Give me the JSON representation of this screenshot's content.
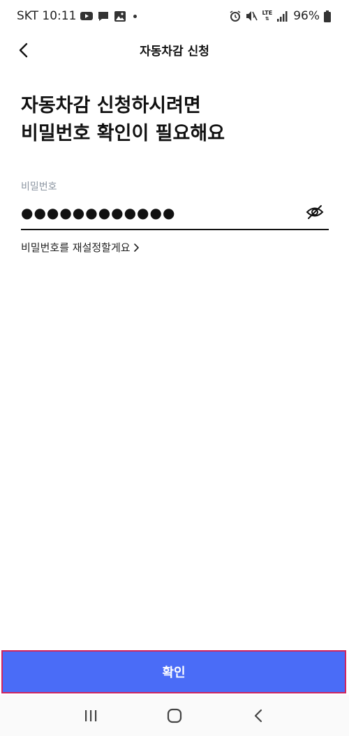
{
  "status_bar": {
    "carrier_time": "SKT 10:11",
    "network": "LTE",
    "battery": "96%"
  },
  "header": {
    "title": "자동차감 신청",
    "back_icon": "chevron-left-icon"
  },
  "headline": {
    "line1": "자동차감 신청하시려면",
    "line2": "비밀번호 확인이 필요해요"
  },
  "password_field": {
    "label": "비밀번호",
    "value": "●●●●●●●●●●●●",
    "toggle_icon": "eye-off-icon"
  },
  "reset_link": {
    "label": "비밀번호를 재설정할게요"
  },
  "confirm_button": {
    "label": "확인",
    "background_color": "#4a6cf7",
    "border_color": "#d0245e"
  },
  "nav_bar": {
    "recents_icon": "recents-icon",
    "home_icon": "home-icon",
    "back_icon": "back-icon"
  }
}
